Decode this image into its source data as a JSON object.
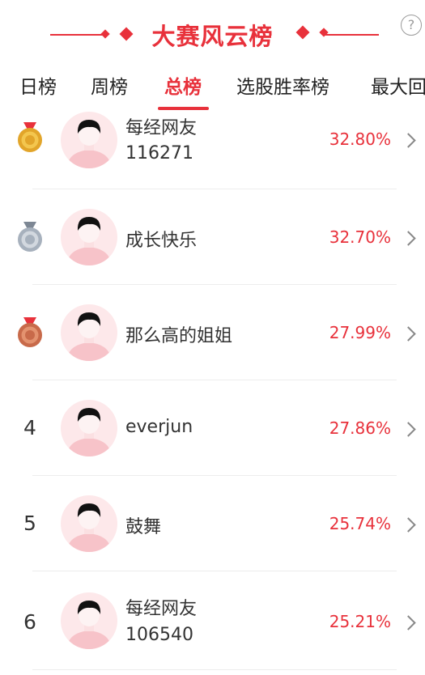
{
  "header": {
    "title": "大赛风云榜",
    "help_symbol": "?"
  },
  "tabs": [
    {
      "label": "日榜",
      "active": false
    },
    {
      "label": "周榜",
      "active": false
    },
    {
      "label": "总榜",
      "active": true
    },
    {
      "label": "选股胜率榜",
      "active": false
    },
    {
      "label": "最大回",
      "active": false
    }
  ],
  "rows": [
    {
      "rank": "1",
      "medal": "gold-medal-icon",
      "name": "每经网友",
      "name2": "116271",
      "pct": "32.80%"
    },
    {
      "rank": "2",
      "medal": "silver-medal-icon",
      "name": "成长快乐",
      "name2": "",
      "pct": "32.70%"
    },
    {
      "rank": "3",
      "medal": "bronze-medal-icon",
      "name": "那么高的姐姐",
      "name2": "",
      "pct": "27.99%"
    },
    {
      "rank": "4",
      "medal": "",
      "name": "everjun",
      "name2": "",
      "pct": "27.86%"
    },
    {
      "rank": "5",
      "medal": "",
      "name": "鼓舞",
      "name2": "",
      "pct": "25.74%"
    },
    {
      "rank": "6",
      "medal": "",
      "name": "每经网友",
      "name2": "106540",
      "pct": "25.21%"
    }
  ],
  "colors": {
    "accent": "#e8313b",
    "gold": "#e2a52a",
    "silver": "#a7b1bd",
    "bronze": "#c86a4a"
  }
}
